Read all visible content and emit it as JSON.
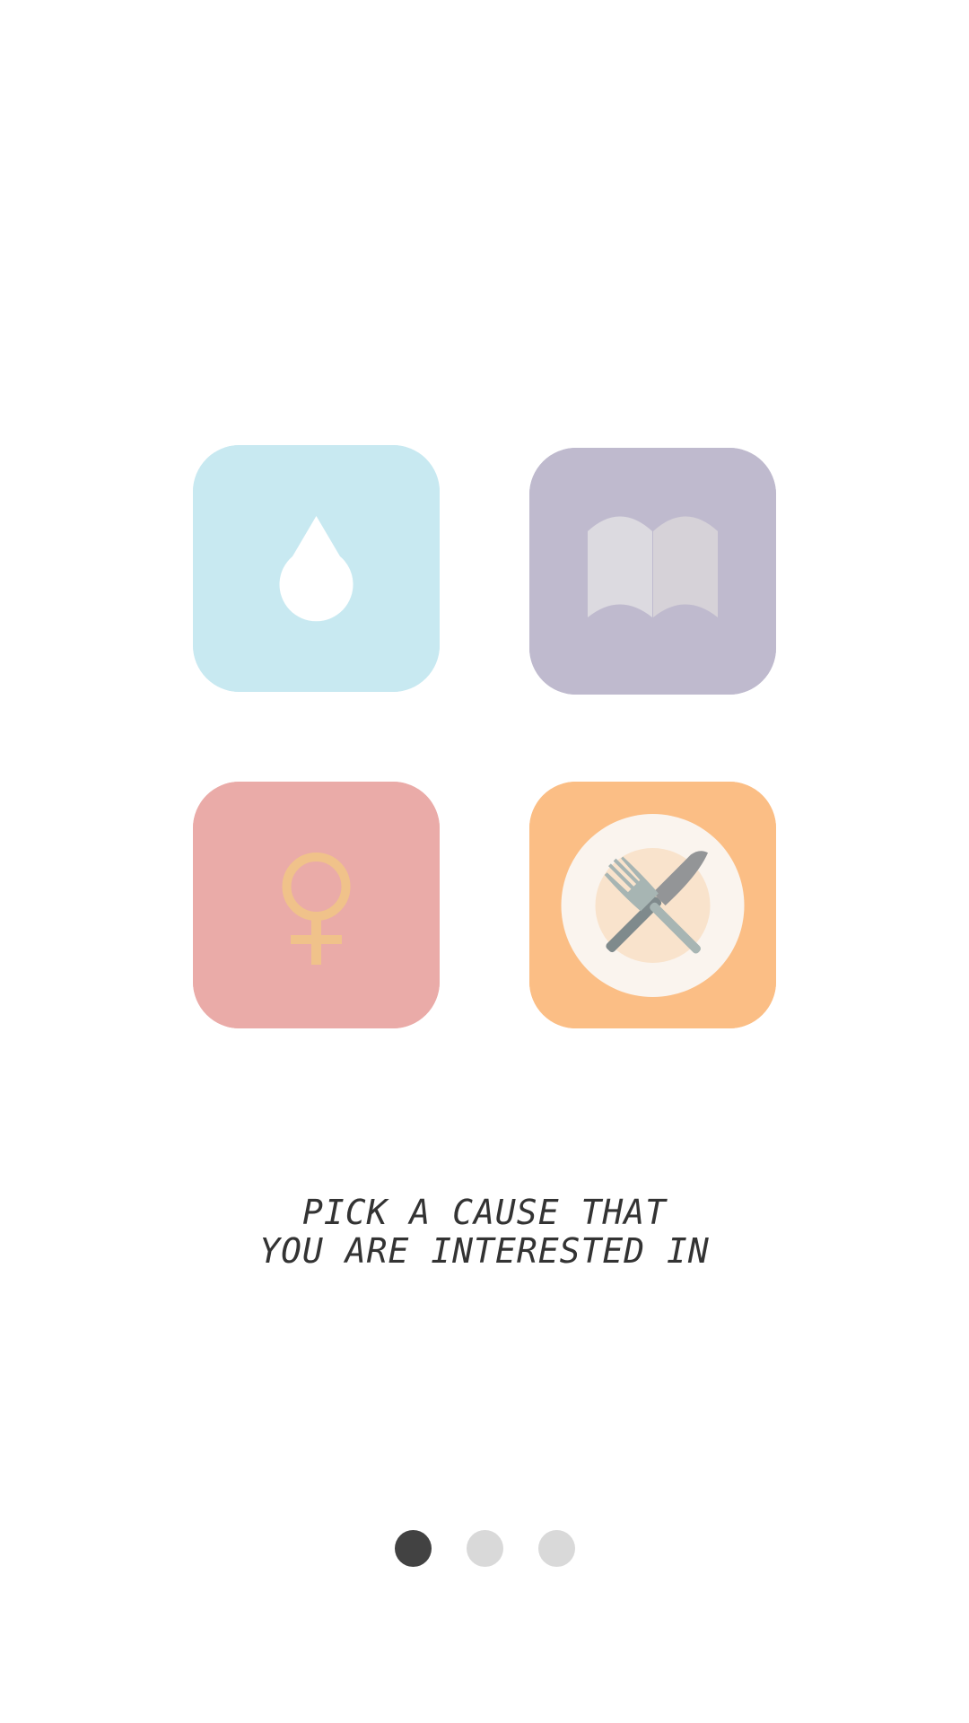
{
  "causes": [
    {
      "id": "water",
      "icon": "water-drop-icon",
      "tile_color": "#C8E9F1"
    },
    {
      "id": "education",
      "icon": "open-book-icon",
      "tile_color": "#BFBACE"
    },
    {
      "id": "women",
      "icon": "female-symbol-icon",
      "tile_color": "#EAABA8"
    },
    {
      "id": "hunger",
      "icon": "plate-fork-knife-icon",
      "tile_color": "#FBBE85"
    }
  ],
  "caption": {
    "line1": "PICK A CAUSE THAT",
    "line2": "YOU ARE INTERESTED IN"
  },
  "pager": {
    "pages": 3,
    "current": 1,
    "active_color": "#424242",
    "inactive_color": "#D9D9D9"
  }
}
